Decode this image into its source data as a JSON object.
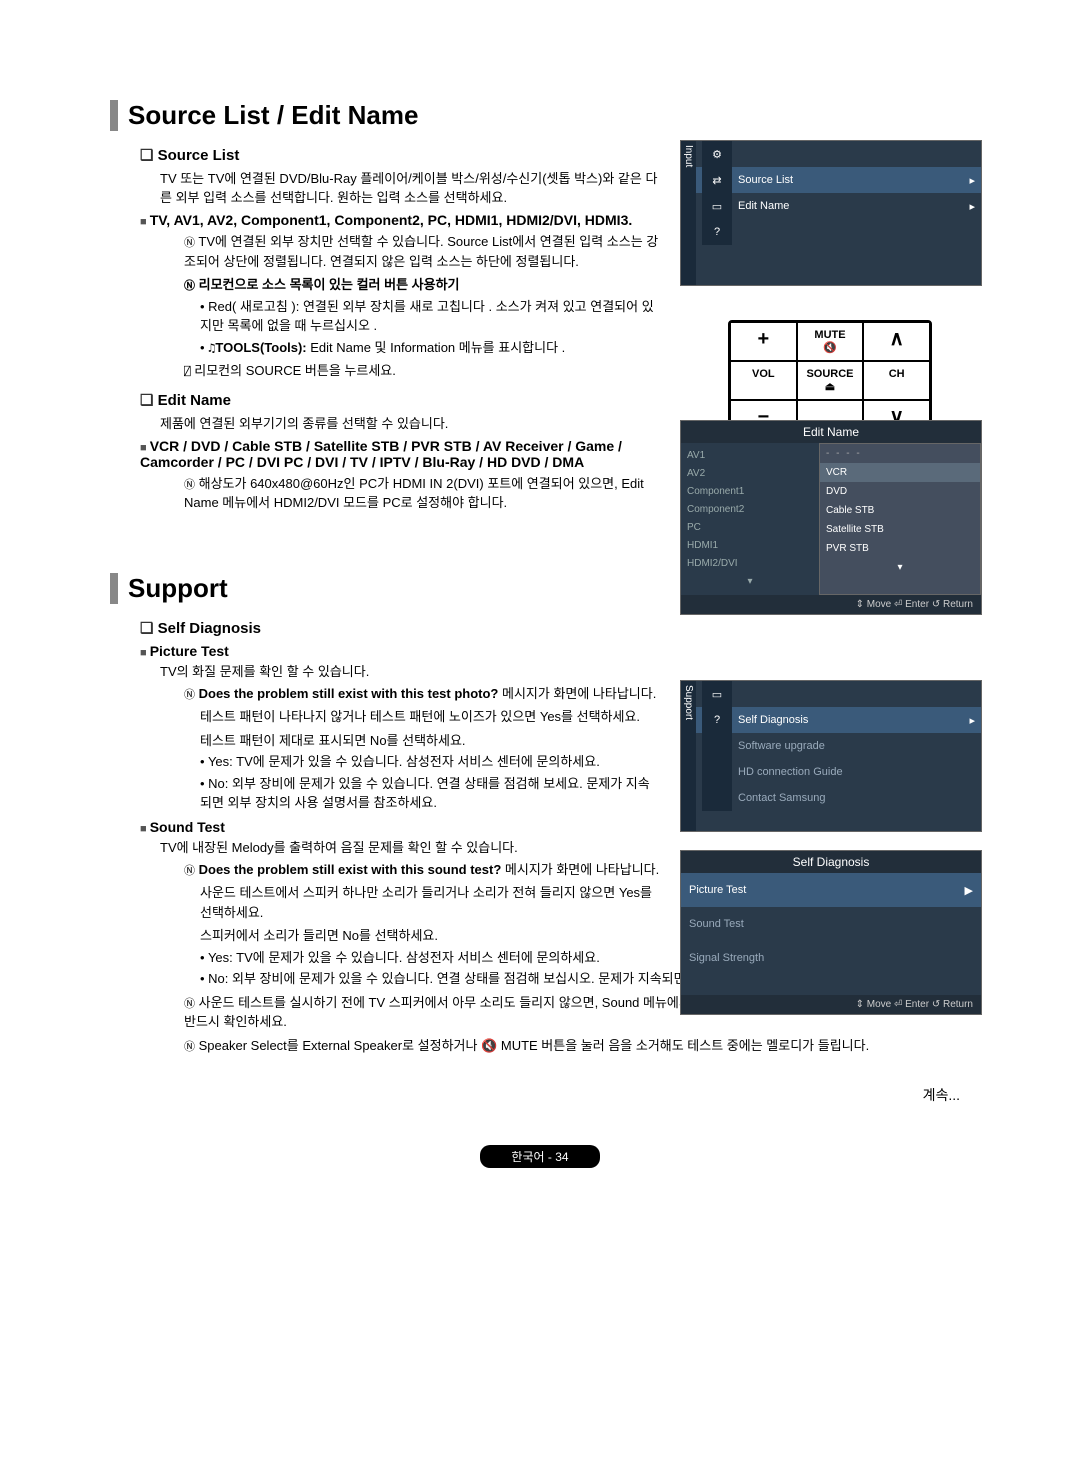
{
  "titles": {
    "section1": "Source List / Edit Name",
    "section2": "Support"
  },
  "source_list": {
    "heading": "Source List",
    "desc": "TV 또는 TV에 연결된 DVD/Blu-Ray 플레이어/케이블 박스/위성/수신기(셋톱 박스)와 같은 다른 외부 입력 소스를 선택합니다. 원하는 입력 소스를 선택하세요.",
    "sources_h": "TV, AV1, AV2, Component1, Component2, PC, HDMI1, HDMI2/DVI, HDMI3.",
    "note1": "TV에 연결된 외부 장치만 선택할 수 있습니다. Source List에서 연결된 입력 소스는 강조되어 상단에 정렬됩니다. 연결되지 않은 입력 소스는 하단에 정렬됩니다.",
    "note2_h": "리모컨으로 소스 목록이 있는 컬러 버튼 사용하기",
    "note2_a": "Red( 새로고침 ): 연결된 외부 장치를 새로 고칩니다 . 소스가 켜져 있고 연결되어 있지만 목록에 없을 때 누르십시오 .",
    "note2_b_prefix": "TOOLS(Tools): ",
    "note2_b": "Edit Name 및 Information 메뉴를 표시합니다 .",
    "note3": "리모컨의 SOURCE 버튼을 누르세요."
  },
  "edit_name": {
    "heading": "Edit Name",
    "desc": "제품에 연결된 외부기기의 종류를 선택할 수 있습니다.",
    "list_h": "VCR / DVD / Cable STB / Satellite STB / PVR STB / AV Receiver / Game / Camcorder / PC / DVI PC / DVI / TV / IPTV / Blu-Ray / HD DVD / DMA",
    "note": "해상도가 640x480@60Hz인 PC가 HDMI IN 2(DVI) 포트에 연결되어 있으면, Edit Name 메뉴에서 HDMI2/DVI 모드를 PC로 설정해야 합니다."
  },
  "support": {
    "self_diag_h": "Self Diagnosis",
    "pic_test": {
      "h": "Picture Test",
      "desc": "TV의 화질 문제를 확인 할 수 있습니다.",
      "q": "Does the problem still exist with this test photo?",
      "q_suffix": " 메시지가 화면에 나타납니다.",
      "l1": "테스트 패턴이 나타나지 않거나 테스트 패턴에 노이즈가 있으면 Yes를 선택하세요.",
      "l2": "테스트 패턴이 제대로 표시되면 No를 선택하세요.",
      "yes": "Yes: TV에 문제가 있을 수 있습니다. 삼성전자 서비스 센터에 문의하세요.",
      "no": "No: 외부 장비에 문제가 있을 수 있습니다. 연결 상태를 점검해 보세요. 문제가 지속되면 외부 장치의 사용 설명서를 참조하세요."
    },
    "snd_test": {
      "h": "Sound Test",
      "desc": "TV에 내장된 Melody를 출력하여 음질 문제를 확인 할 수 있습니다.",
      "q": "Does the problem still exist with this sound test?",
      "q_suffix": " 메시지가 화면에 나타납니다.",
      "l1": "사운드 테스트에서 스피커 하나만 소리가 들리거나 소리가 전혀 들리지 않으면 Yes를 선택하세요.",
      "l2": "스피커에서 소리가 들리면 No를 선택하세요.",
      "yes": "Yes: TV에 문제가 있을 수 있습니다. 삼성전자 서비스 센터에 문의하세요.",
      "no": "No: 외부 장비에 문제가 있을 수 있습니다. 연결 상태를 점검해 보십시오. 문제가 지속되면 외부 장치의 사용 설명서를 참조하세요.",
      "n2": "사운드 테스트를 실시하기 전에 TV 스피커에서 아무 소리도 들리지 않으면, Sound 메뉴에서 Speaker Select가 TV speaker로 설정되어 있는지 반드시 확인하세요.",
      "n3": "Speaker Select를 External Speaker로 설정하거나 🔇 MUTE 버튼을 눌러 음을 소거해도 테스트 중에는 멜로디가 들립니다."
    }
  },
  "osd1": {
    "tab": "Input",
    "items": [
      "Source List",
      "Edit Name"
    ]
  },
  "remote": {
    "mute": "MUTE",
    "vol": "VOL",
    "source": "SOURCE",
    "ch": "CH"
  },
  "osd_edit": {
    "title": "Edit Name",
    "left": [
      "AV1",
      "AV2",
      "Component1",
      "Component2",
      "PC",
      "HDMI1",
      "HDMI2/DVI"
    ],
    "right_dash": "- - - -",
    "right": [
      "VCR",
      "DVD",
      "Cable STB",
      "Satellite STB",
      "PVR STB"
    ],
    "footer": "⇕ Move   ⏎ Enter   ↺ Return"
  },
  "osd_support": {
    "tab": "Support",
    "items": [
      "Self Diagnosis",
      "Software upgrade",
      "HD connection Guide",
      "Contact Samsung"
    ]
  },
  "osd_selfdiag": {
    "title": "Self Diagnosis",
    "items": [
      "Picture Test",
      "Sound Test",
      "Signal Strength"
    ],
    "arrow": "▶",
    "footer": "⇕ Move   ⏎ Enter   ↺ Return"
  },
  "footer": {
    "page": "한국어 - 34",
    "cont": "계속..."
  }
}
